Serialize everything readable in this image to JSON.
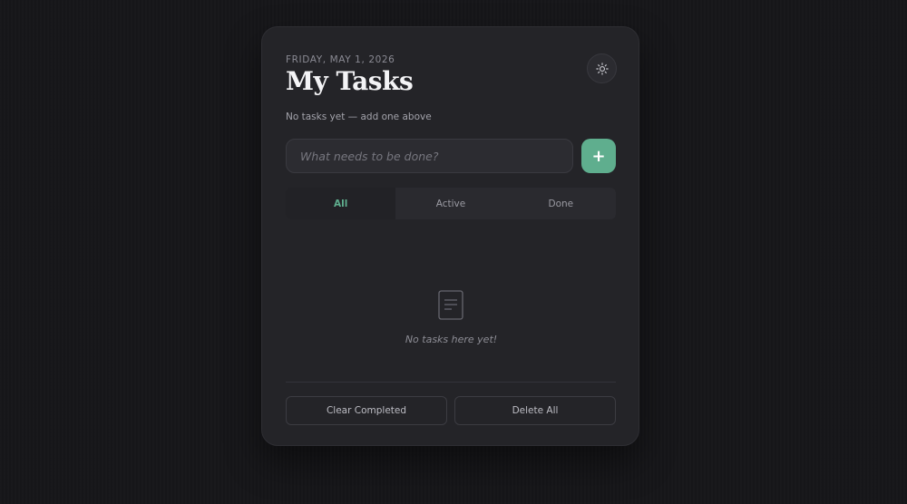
{
  "header": {
    "date": "FRIDAY, MAY 1, 2026",
    "title": "My Tasks",
    "theme_toggle_icon": "sun-icon",
    "subtitle": "No tasks yet — add one above"
  },
  "input": {
    "placeholder": "What needs to be done?",
    "value": "",
    "add_label": "+"
  },
  "filters": [
    {
      "label": "All",
      "active": true
    },
    {
      "label": "Active",
      "active": false
    },
    {
      "label": "Done",
      "active": false
    }
  ],
  "empty_state": {
    "icon": "document-icon",
    "text": "No tasks here yet!"
  },
  "footer": {
    "clear_label": "Clear Completed",
    "delete_label": "Delete All"
  },
  "colors": {
    "accent": "#5fae8e",
    "background": "#161619",
    "card": "#242428"
  }
}
